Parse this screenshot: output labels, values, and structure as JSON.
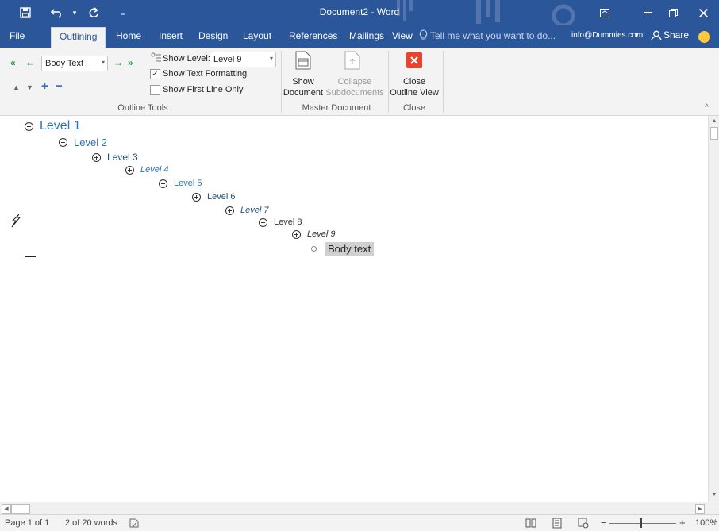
{
  "titlebar": {
    "document_title": "Document2 - Word",
    "save_icon": "save-icon",
    "undo_icon": "undo-icon",
    "redo_icon": "redo-icon",
    "customize_icon": "customize-qat-icon"
  },
  "tabs": [
    {
      "label": "File"
    },
    {
      "label": "Outlining"
    },
    {
      "label": "Home"
    },
    {
      "label": "Insert"
    },
    {
      "label": "Design"
    },
    {
      "label": "Layout"
    },
    {
      "label": "References"
    },
    {
      "label": "Mailings"
    },
    {
      "label": "View"
    }
  ],
  "tell_me": "Tell me what you want to do...",
  "account": "info@Dummies.com",
  "share_label": "Share",
  "ribbon": {
    "outline_tools": {
      "group_label": "Outline Tools",
      "level_combo_value": "Body Text",
      "show_level_label": "Show Level:",
      "show_level_value": "Level 9",
      "show_text_formatting": "Show Text Formatting",
      "show_text_formatting_checked": true,
      "show_first_line_only": "Show First Line Only",
      "show_first_line_only_checked": false
    },
    "master_document": {
      "group_label": "Master Document",
      "show_document_line1": "Show",
      "show_document_line2": "Document",
      "collapse_line1": "Collapse",
      "collapse_line2": "Subdocuments"
    },
    "close": {
      "group_label": "Close",
      "close_line1": "Close",
      "close_line2": "Outline View"
    }
  },
  "outline": [
    {
      "text": "Level 1",
      "kind": "heading"
    },
    {
      "text": "Level 2",
      "kind": "heading"
    },
    {
      "text": "Level 3",
      "kind": "heading"
    },
    {
      "text": "Level 4",
      "kind": "heading"
    },
    {
      "text": "Level 5",
      "kind": "heading"
    },
    {
      "text": "Level 6",
      "kind": "heading"
    },
    {
      "text": "Level 7",
      "kind": "heading"
    },
    {
      "text": "Level 8",
      "kind": "heading"
    },
    {
      "text": "Level 9",
      "kind": "heading"
    },
    {
      "text": "Body text",
      "kind": "body"
    }
  ],
  "status": {
    "page": "Page 1 of 1",
    "words": "2 of 20 words",
    "zoom": "100%"
  },
  "colors": {
    "accent": "#2b579a",
    "heading_blue": "#2e74b5",
    "close_red": "#e8432f"
  }
}
